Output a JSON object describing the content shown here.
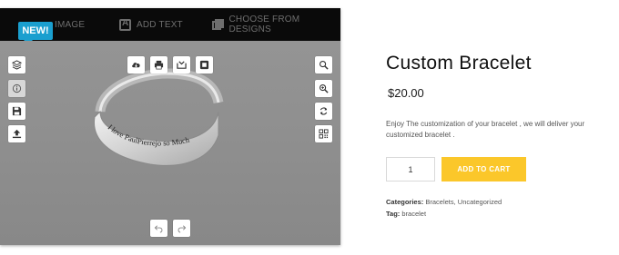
{
  "designer": {
    "badge": "NEW!",
    "tabs": [
      {
        "label": "IMAGE",
        "icon": "image-icon"
      },
      {
        "label": "ADD TEXT",
        "icon": "text-icon"
      },
      {
        "label": "CHOOSE FROM DESIGNS",
        "icon": "designs-icon"
      }
    ],
    "engraving": "I love PaulPierrejo so Much",
    "left_tools": [
      "layers-icon",
      "info-icon",
      "save-icon",
      "upload-icon"
    ],
    "top_tools": [
      "cloud-download-icon",
      "print-icon",
      "share-icon",
      "crop-icon"
    ],
    "right_tools": [
      "zoom-out-icon",
      "zoom-in-icon",
      "reset-icon",
      "qr-code-icon"
    ],
    "bottom_tools": [
      "undo-icon",
      "redo-icon"
    ]
  },
  "product": {
    "title": "Custom Bracelet",
    "price": "$20.00",
    "description": "Enjoy The customization of your bracelet , we will deliver your customized bracelet .",
    "quantity": "1",
    "add_to_cart_label": "ADD TO CART",
    "categories_label": "Categories:",
    "categories": [
      "Bracelets",
      "Uncategorized"
    ],
    "categories_sep": ", ",
    "tag_label": "Tag:",
    "tag": "bracelet"
  },
  "colors": {
    "accent": "#fbc72a",
    "badge": "#1a9fcf",
    "toolbar": "#0a0a0a"
  }
}
